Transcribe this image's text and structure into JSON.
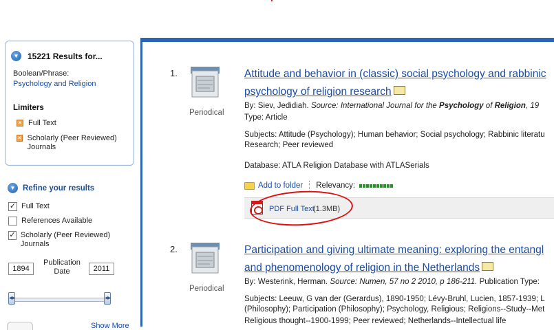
{
  "results_panel": {
    "count_title": "15221 Results for...",
    "boolean_label": "Boolean/Phrase:",
    "query": "Psychology and Religion",
    "limiters_title": "Limiters",
    "limiters": [
      "Full Text",
      "Scholarly (Peer Reviewed) Journals"
    ]
  },
  "refine": {
    "title": "Refine your results",
    "options": [
      {
        "label": "Full Text",
        "checked": true
      },
      {
        "label": "References Available",
        "checked": false
      },
      {
        "label": "Scholarly (Peer Reviewed) Journals",
        "checked": true
      }
    ],
    "date_from": "1894",
    "date_to": "2011",
    "date_label": "Publication Date",
    "show_more": "Show More"
  },
  "results": [
    {
      "number": "1.",
      "pubtype": "Periodical",
      "title_line1": "Attitude and behavior in (classic) social psychology and rabbinic",
      "title_line2": "psychology of religion research",
      "by_prefix": "By: Siev, Jedidiah.",
      "source_label": "Source:",
      "source_text": "International Journal for the",
      "source_bold1": "Psychology",
      "source_of": "of",
      "source_bold2": "Religion",
      "source_tail": ", 19",
      "type": "Type: Article",
      "subjects_line1": "Subjects: Attitude (Psychology); Human behavior; Social psychology; Rabbinic literatu",
      "subjects_line2": "Research; Peer reviewed",
      "database": "Database: ATLA Religion Database with ATLASerials",
      "add_to_folder": "Add to folder",
      "relevancy_label": "Relevancy:",
      "relevancy_level": 10,
      "pdf_label": "PDF Full Text",
      "pdf_size": "(1.3MB)"
    },
    {
      "number": "2.",
      "pubtype": "Periodical",
      "title_line1": "Participation and giving ultimate meaning: exploring the entangl",
      "title_line2": "and phenomenology of religion in the Netherlands",
      "by_prefix": "By: Westerink, Herman.",
      "source_label": "Source:",
      "source_text": "Numen, 57 no 2 2010, p 186-211.",
      "pub_type_text": "Publication Type:",
      "subjects_line1": "Subjects: Leeuw, G van der (Gerardus), 1890-1950; Lévy-Bruhl, Lucien, 1857-1939; L",
      "subjects_line2": "(Philosophy); Participation (Philosophy); Psychology, Religious; Religions--Study--Met",
      "subjects_line3": "Religious thought--1900-1999; Peer reviewed; Netherlands--Intellectual life"
    }
  ],
  "colors": {
    "accent": "#2a66b5",
    "link": "#1a4ca8",
    "annotation": "#e01010"
  }
}
